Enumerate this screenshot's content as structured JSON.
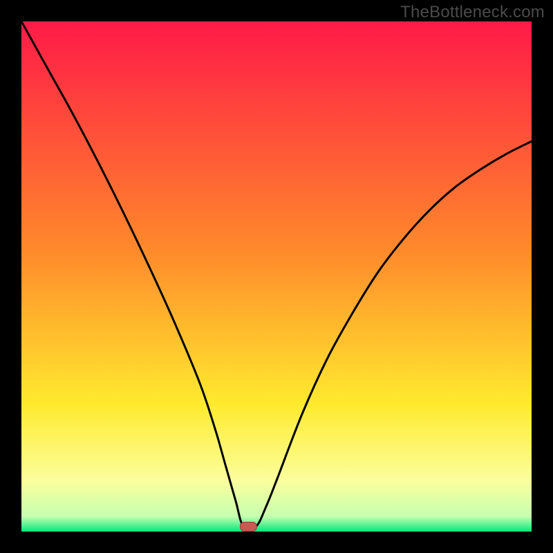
{
  "watermark": "TheBottleneck.com",
  "colors": {
    "bg": "#000000",
    "grad_top": "#ff1a47",
    "grad_mid1": "#ff8a2b",
    "grad_mid2": "#ffea2e",
    "grad_low": "#fbff9d",
    "grad_base": "#05e97a",
    "curve": "#000000",
    "marker_fill": "#c85a54",
    "marker_stroke": "#8f3a36"
  },
  "chart_data": {
    "type": "line",
    "title": "",
    "xlabel": "",
    "ylabel": "",
    "xlim": [
      0,
      100
    ],
    "ylim": [
      0,
      100
    ],
    "series": [
      {
        "name": "bottleneck-curve",
        "x_percent": [
          0,
          5,
          10,
          15,
          20,
          25,
          30,
          35,
          38,
          40,
          42,
          43.5,
          46,
          48,
          50,
          55,
          60,
          65,
          70,
          75,
          80,
          85,
          90,
          95,
          100
        ],
        "y_percent": [
          100,
          91,
          82,
          72.5,
          62.5,
          52,
          41,
          29,
          20,
          13,
          6,
          1,
          1,
          5,
          10,
          23,
          34,
          43,
          51,
          57.5,
          63,
          67.5,
          71,
          74,
          76.5
        ]
      }
    ],
    "marker": {
      "x_percent": 44.5,
      "y_percent": 0.9
    },
    "gradient_stops_percent_from_top": [
      {
        "pct": 0,
        "color": "#ff1a47"
      },
      {
        "pct": 45,
        "color": "#ff8a2b"
      },
      {
        "pct": 75,
        "color": "#ffea2e"
      },
      {
        "pct": 90,
        "color": "#fbff9d"
      },
      {
        "pct": 97,
        "color": "#c7ffb0"
      },
      {
        "pct": 100,
        "color": "#05e97a"
      }
    ]
  }
}
